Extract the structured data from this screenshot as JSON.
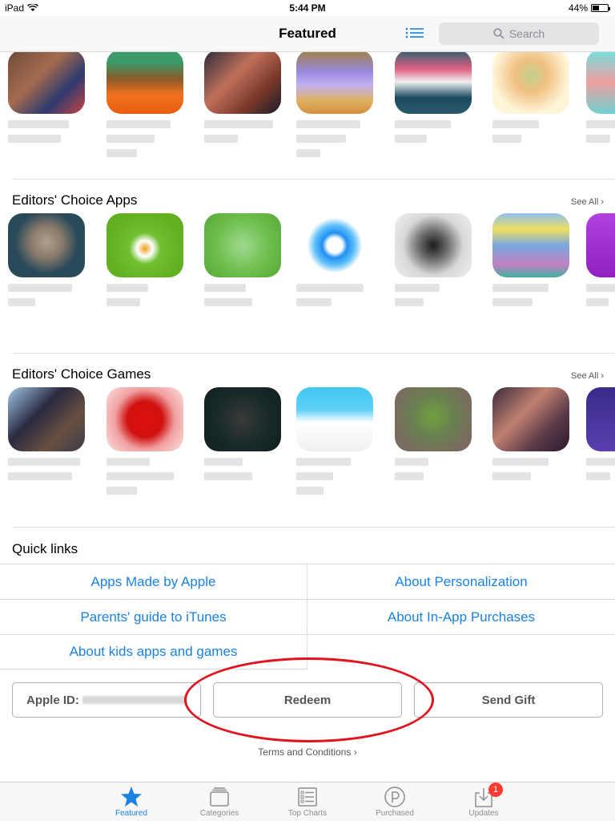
{
  "status": {
    "device": "iPad",
    "time": "5:44 PM",
    "battery": "44%",
    "battery_level": 0.44
  },
  "nav": {
    "title": "Featured",
    "search_placeholder": "Search"
  },
  "shelves": [
    {
      "title": "Editors' Choice Apps",
      "see_all": "See All"
    },
    {
      "title": "Editors' Choice Games",
      "see_all": "See All"
    }
  ],
  "quick_links": {
    "title": "Quick links",
    "items": [
      "Apps Made by Apple",
      "About Personalization",
      "Parents' guide to iTunes",
      "About In-App Purchases",
      "About kids apps and games"
    ]
  },
  "account": {
    "apple_id_label": "Apple ID:",
    "redeem": "Redeem",
    "send_gift": "Send Gift",
    "terms": "Terms and Conditions"
  },
  "tabs": [
    {
      "label": "Featured",
      "icon": "star-icon"
    },
    {
      "label": "Categories",
      "icon": "categories-icon"
    },
    {
      "label": "Top Charts",
      "icon": "top-charts-icon"
    },
    {
      "label": "Purchased",
      "icon": "purchased-icon"
    },
    {
      "label": "Updates",
      "icon": "updates-icon",
      "badge": "1"
    }
  ],
  "colors": {
    "accent": "#1a82e2",
    "highlight_circle": "#e0141e",
    "badge": "#ff3b30"
  }
}
